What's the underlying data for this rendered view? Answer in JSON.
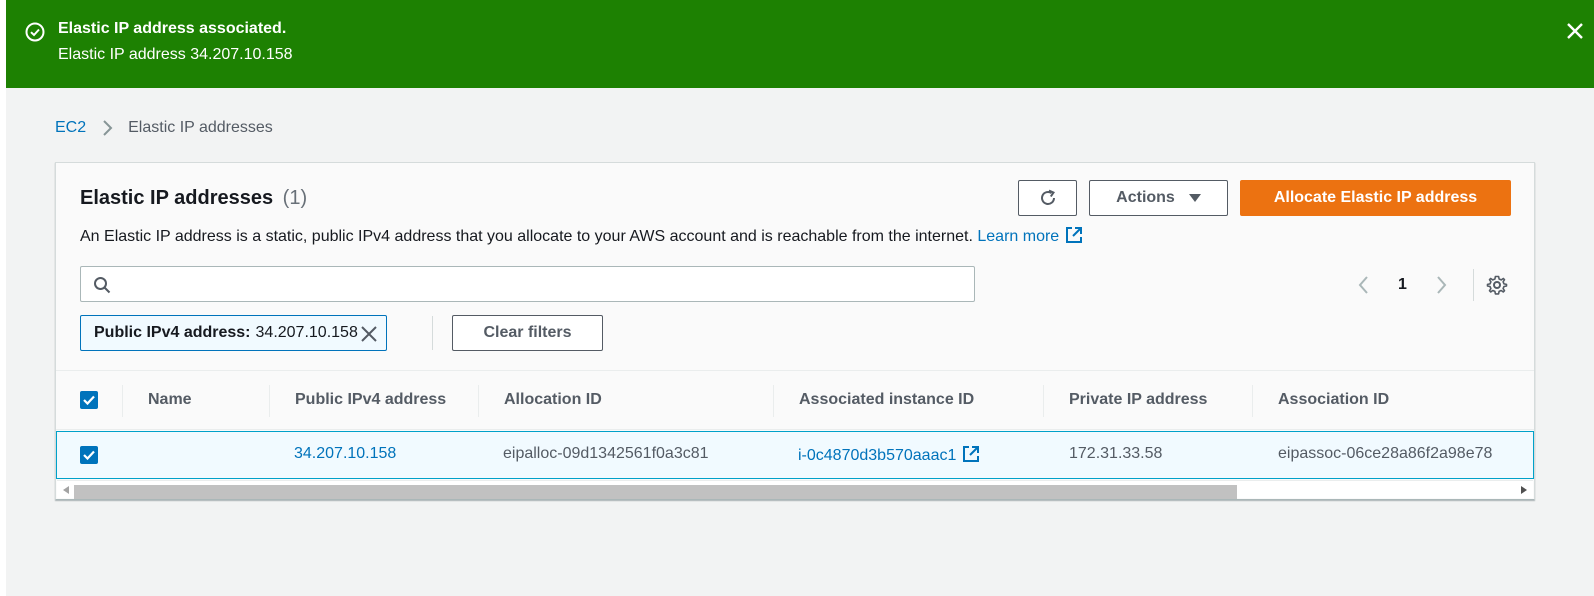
{
  "flash": {
    "title": "Elastic IP address associated.",
    "message": "Elastic IP address 34.207.10.158",
    "color": "#1d8102"
  },
  "breadcrumb": {
    "root": "EC2",
    "current": "Elastic IP addresses"
  },
  "panel": {
    "title": "Elastic IP addresses",
    "count": "(1)",
    "description": "An Elastic IP address is a static, public IPv4 address that you allocate to your AWS account and is reachable from the internet.",
    "learn_more": "Learn more",
    "actions_label": "Actions",
    "allocate_label": "Allocate Elastic IP address",
    "accent_color": "#ec7211"
  },
  "search": {
    "value": "",
    "placeholder": ""
  },
  "pagination": {
    "current_page": "1"
  },
  "filter": {
    "key": "Public IPv4 address:",
    "value": "34.207.10.158",
    "clear_label": "Clear filters"
  },
  "table": {
    "columns": [
      "Name",
      "Public IPv4 address",
      "Allocation ID",
      "Associated instance ID",
      "Private IP address",
      "Association ID"
    ],
    "rows": [
      {
        "selected": true,
        "name": "",
        "public_ip": "34.207.10.158",
        "allocation_id": "eipalloc-09d1342561f0a3c81",
        "instance_id": "i-0c4870d3b570aaac1",
        "private_ip": "172.31.33.58",
        "association_id": "eipassoc-06ce28a86f2a98e78"
      }
    ]
  }
}
